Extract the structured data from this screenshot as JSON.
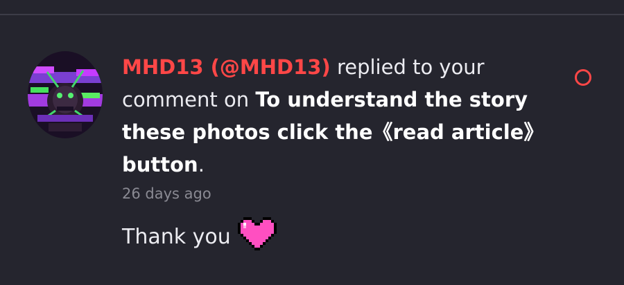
{
  "notification": {
    "user": {
      "display": "MHD13 (@MHD13)"
    },
    "action_text": " replied to your comment on ",
    "post_title": "To understand the story these photos click the《read article》button",
    "end_punct": ".",
    "timestamp": "26 days ago",
    "reply": "Thank you",
    "reply_emoji": "pixel-heart-icon",
    "unread": true
  },
  "colors": {
    "background": "#25252e",
    "username": "#ff4747",
    "text": "#ececf1",
    "muted": "#8a8a93",
    "heart": "#ff4fc1"
  }
}
